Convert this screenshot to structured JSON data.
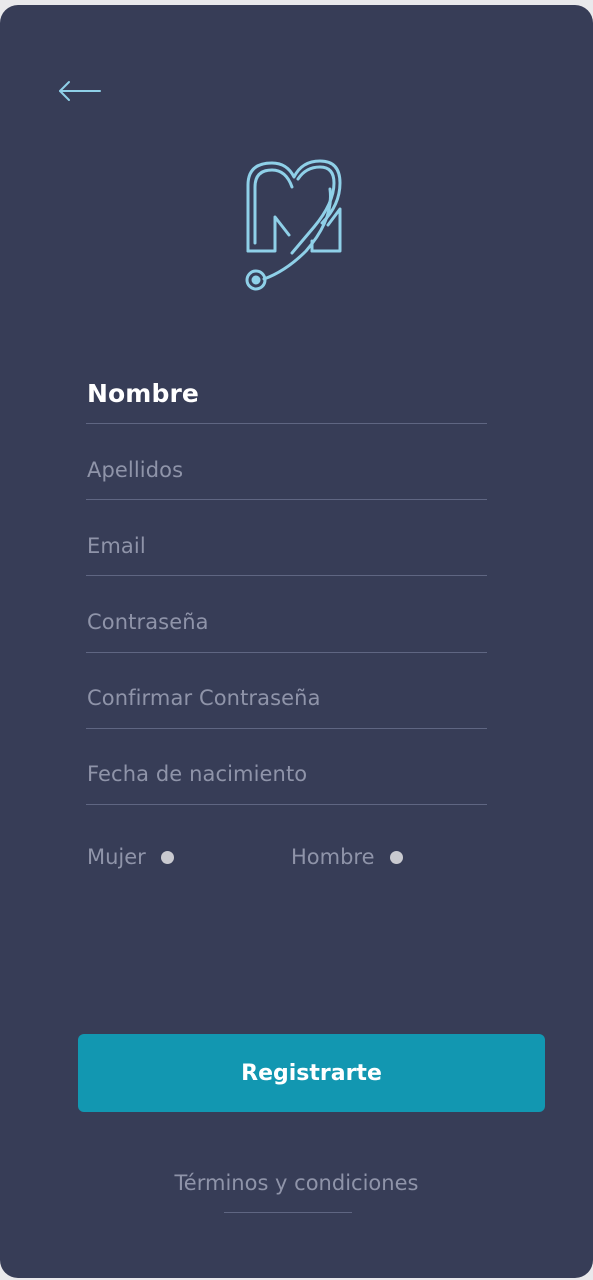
{
  "colors": {
    "background": "#373d57",
    "accent": "#1297b1",
    "logo": "#8fd0e8",
    "muted_text": "#8f94a9",
    "divider": "#5f6682"
  },
  "header": {
    "back_icon": "back-arrow-icon",
    "logo_icon": "heart-stethoscope-logo-icon"
  },
  "form": {
    "fields": [
      {
        "label": "Nombre",
        "active": true
      },
      {
        "label": "Apellidos"
      },
      {
        "label": "Email"
      },
      {
        "label": "Contraseña"
      },
      {
        "label": "Confirmar Contraseña"
      },
      {
        "label": "Fecha de nacimiento"
      }
    ],
    "gender": {
      "female_label": "Mujer",
      "male_label": "Hombre"
    }
  },
  "actions": {
    "register_label": "Registrarte",
    "terms_label": "Términos y condiciones"
  }
}
